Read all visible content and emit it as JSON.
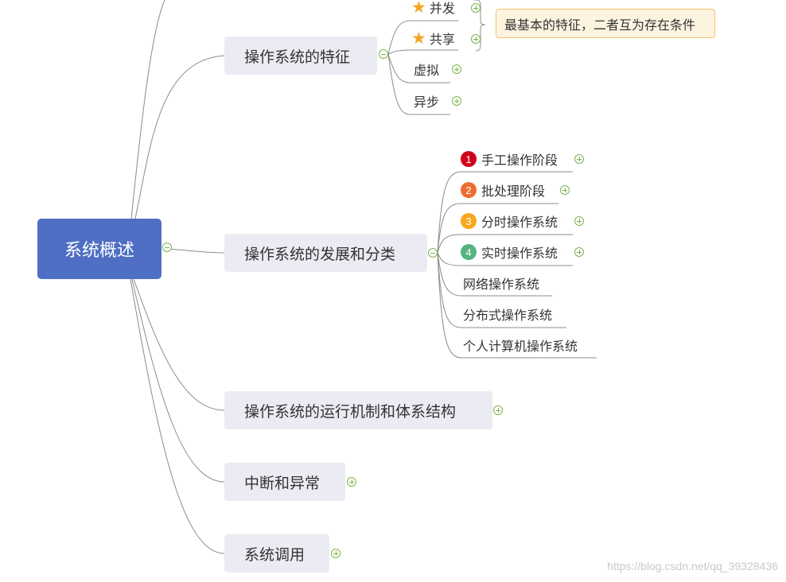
{
  "root": {
    "label": "系统概述"
  },
  "branches": [
    {
      "label": "操作系统的特征",
      "children": [
        {
          "label": "并发",
          "icon": "star-icon"
        },
        {
          "label": "共享",
          "icon": "star-icon"
        },
        {
          "label": "虚拟"
        },
        {
          "label": "异步"
        }
      ],
      "callout": "最基本的特征，二者互为存在条件"
    },
    {
      "label": "操作系统的发展和分类",
      "children": [
        {
          "label": "手工操作阶段",
          "badge": "1",
          "badge_color": "#d0021b"
        },
        {
          "label": "批处理阶段",
          "badge": "2",
          "badge_color": "#ee6d2e"
        },
        {
          "label": "分时操作系统",
          "badge": "3",
          "badge_color": "#f8a71b"
        },
        {
          "label": "实时操作系统",
          "badge": "4",
          "badge_color": "#55b47f"
        },
        {
          "label": "网络操作系统"
        },
        {
          "label": "分布式操作系统"
        },
        {
          "label": "个人计算机操作系统"
        }
      ]
    },
    {
      "label": "操作系统的运行机制和体系结构"
    },
    {
      "label": "中断和异常"
    },
    {
      "label": "系统调用"
    }
  ],
  "colors": {
    "root": "#4f6fc4",
    "topic_bg": "#ebebf3",
    "toggle": "#7cb34d",
    "star": "#f5a623",
    "callout_bg": "#fdf4e0",
    "callout_border": "#f3c46c"
  },
  "watermark": "https://blog.csdn.net/qq_39328436"
}
